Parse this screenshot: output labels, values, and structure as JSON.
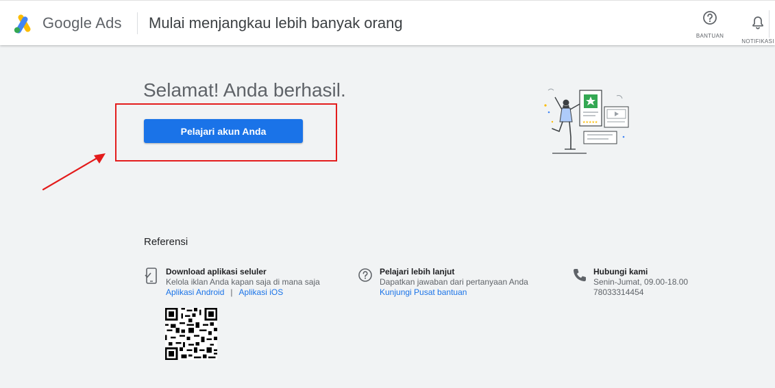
{
  "header": {
    "brand_name": "Google Ads",
    "page_heading": "Mulai menjangkau lebih banyak orang",
    "help_label": "BANTUAN",
    "notifications_label": "NOTIFIKASI"
  },
  "main": {
    "success_title": "Selamat! Anda berhasil.",
    "primary_button_label": "Pelajari akun Anda"
  },
  "references": {
    "title": "Referensi",
    "mobile_app": {
      "icon": "phone-check-icon",
      "heading": "Download aplikasi seluler",
      "description": "Kelola iklan Anda kapan saja di mana saja",
      "android_link": "Aplikasi Android",
      "separator": "|",
      "ios_link": "Aplikasi iOS"
    },
    "learn_more": {
      "icon": "help-circle-icon",
      "heading": "Pelajari lebih lanjut",
      "description": "Dapatkan jawaban dari pertanyaan Anda",
      "link": "Kunjungi Pusat bantuan"
    },
    "contact": {
      "icon": "phone-icon",
      "heading": "Hubungi kami",
      "hours": "Senin-Jumat, 09.00-18.00",
      "phone": "78033314454"
    }
  },
  "colors": {
    "primary_blue": "#1a73e8",
    "annotation_red": "#e31b1b",
    "background": "#f1f3f4"
  }
}
